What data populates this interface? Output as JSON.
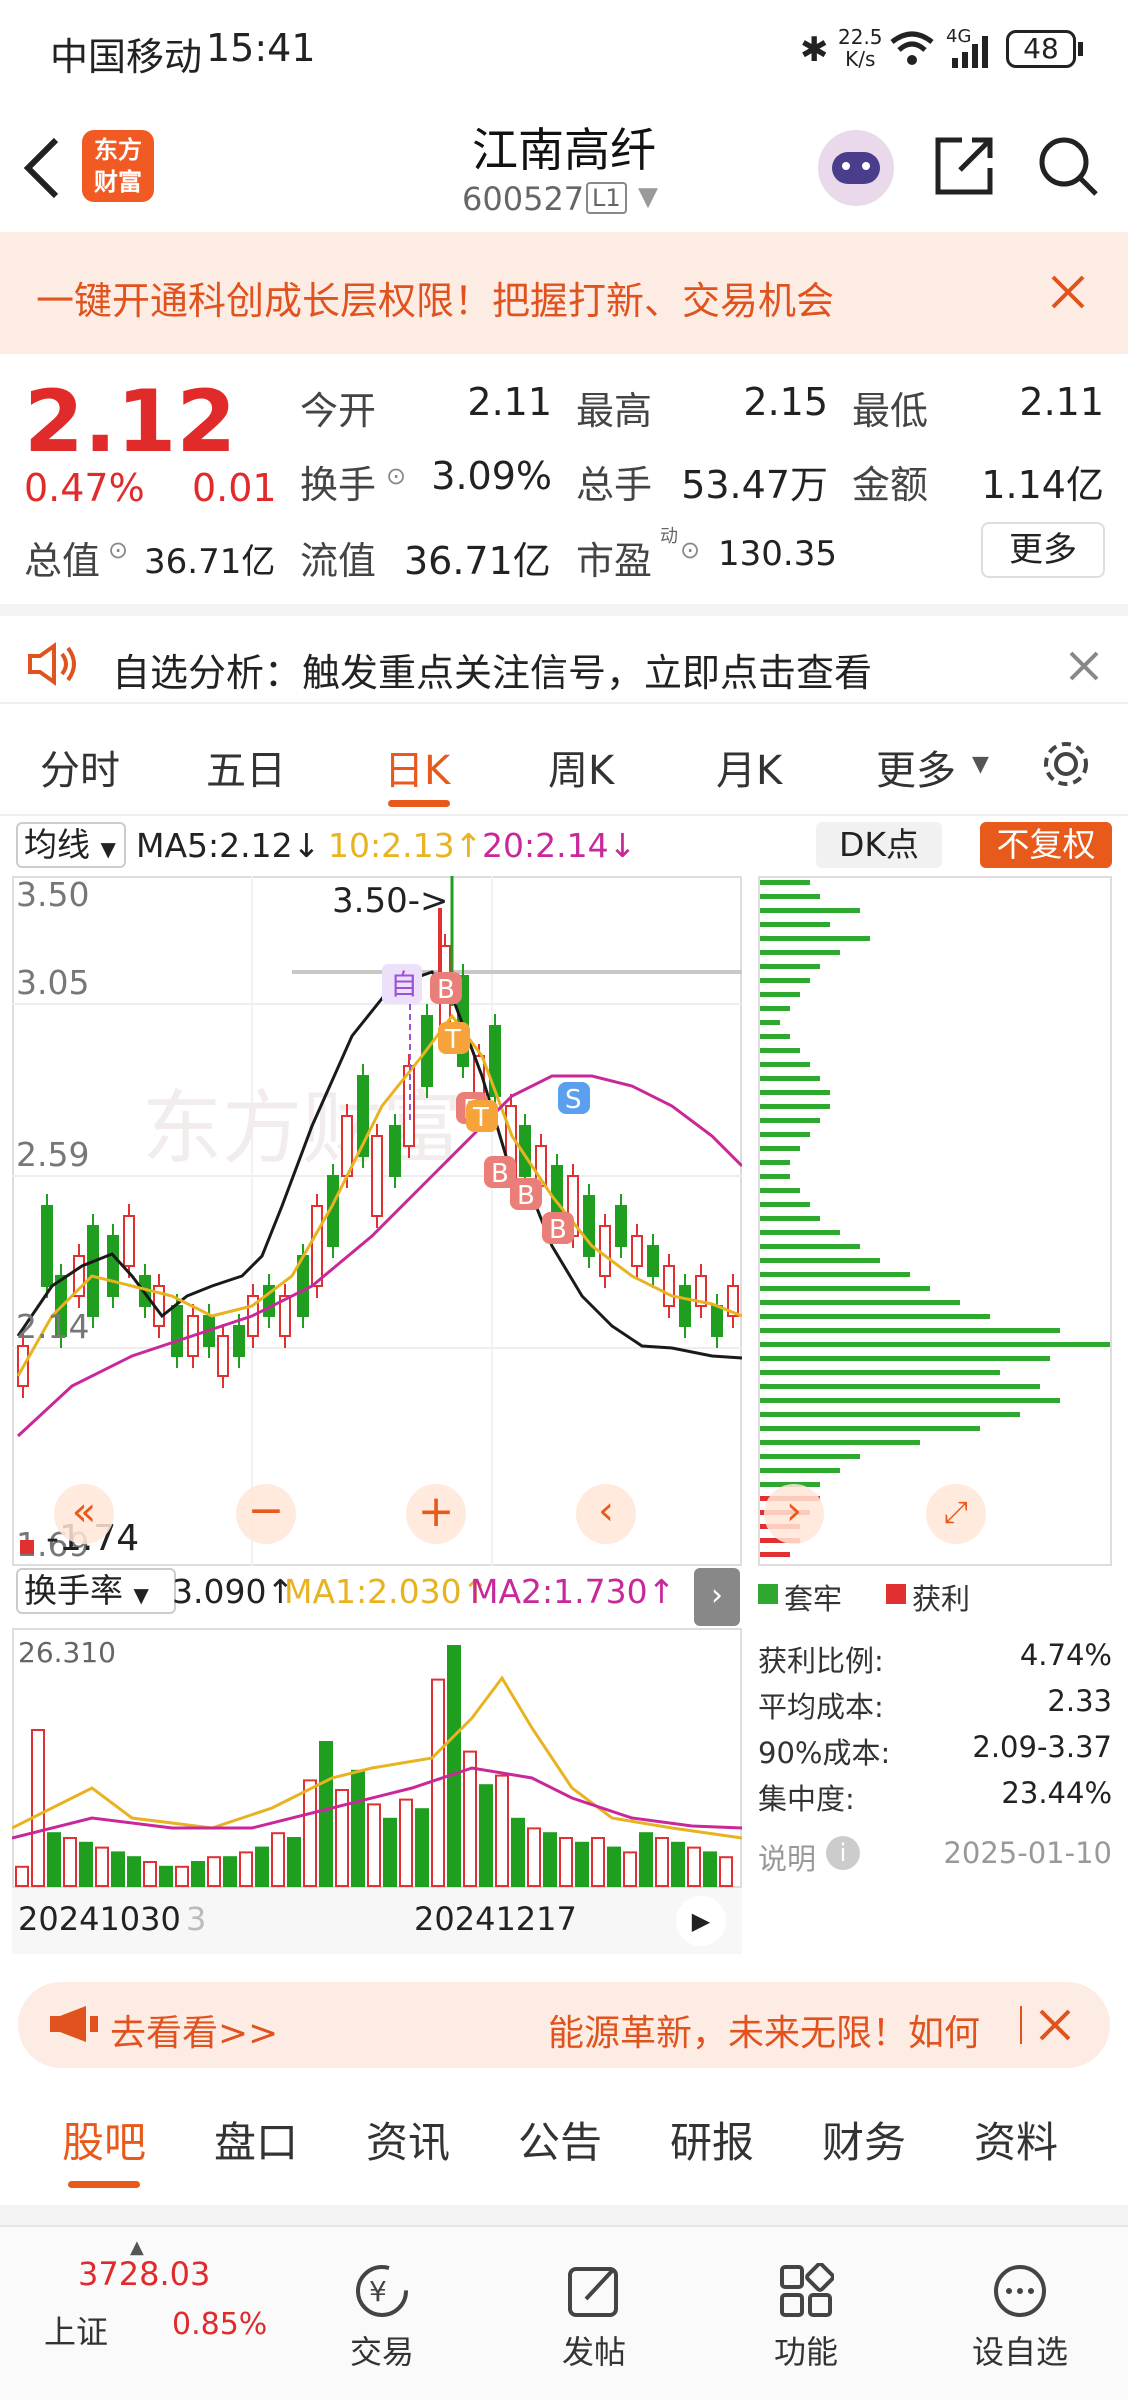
{
  "status": {
    "carrier": "中国移动",
    "time": "15:41",
    "speed_top": "22.5",
    "speed_bot": "K/s",
    "net": "4G",
    "battery": "48"
  },
  "header": {
    "logo_l1": "东方",
    "logo_l2": "财富",
    "name": "江南高纤",
    "code": "600527",
    "level": "L1"
  },
  "banner": {
    "text": "一键开通科创成长层权限！把握打新、交易机会"
  },
  "quote": {
    "price": "2.12",
    "pct": "0.47%",
    "chg": "0.01",
    "open_lbl": "今开",
    "open": "2.11",
    "high_lbl": "最高",
    "high": "2.15",
    "low_lbl": "最低",
    "low": "2.11",
    "turn_lbl": "换手",
    "turn": "3.09%",
    "vol_lbl": "总手",
    "vol": "53.47万",
    "amt_lbl": "金额",
    "amt": "1.14亿",
    "mcap_lbl": "总值",
    "mcap": "36.71亿",
    "float_lbl": "流值",
    "float": "36.71亿",
    "pe_lbl": "市盈",
    "pe_sup": "动",
    "pe": "130.35",
    "more": "更多"
  },
  "notice": {
    "text": "自选分析：触发重点关注信号，立即点击查看"
  },
  "tabs": [
    "分时",
    "五日",
    "日K",
    "周K",
    "月K",
    "更多"
  ],
  "active_tab": "日K",
  "kline": {
    "ma_btn": "均线",
    "ma5": "MA5:2.12↓",
    "ma10": "10:2.13↑",
    "ma20": "20:2.14↓",
    "dk": "DK点",
    "fq": "不复权",
    "ticks": [
      "3.50",
      "3.05",
      "2.59",
      "2.14",
      "1.69"
    ],
    "max_label": "3.50->",
    "min_label": "1.74",
    "self_tag": "自",
    "colors": {
      "up": "#e03030",
      "down": "#1f9e1f",
      "ma5": "#222222",
      "ma10": "#e8b320",
      "ma20": "#c8289a"
    }
  },
  "volume": {
    "btn": "换手率",
    "v": "3.090↑",
    "ma1": "MA1:2.030↑",
    "ma2": "MA2:1.730↑",
    "top": "26.310",
    "d1": "20241030",
    "d1_tail": "3",
    "d2": "20241217"
  },
  "chips": {
    "legend_a": "套牢",
    "legend_b": "获利",
    "rows": [
      {
        "l": "获利比例:",
        "v": "4.74%"
      },
      {
        "l": "平均成本:",
        "v": "2.33"
      },
      {
        "l": "90%成本:",
        "v": "2.09-3.37"
      },
      {
        "l": "集中度:",
        "v": "23.44%"
      }
    ],
    "note": "说明",
    "date": "2025-01-10"
  },
  "ad": {
    "left": "去看看>>",
    "right": "能源革新，未来无限！如何"
  },
  "bottom_tabs": [
    "股吧",
    "盘口",
    "资讯",
    "公告",
    "研报",
    "财务",
    "资料"
  ],
  "nav": {
    "index_val": "3728.03",
    "index_name": "上证",
    "index_pct": "0.85%",
    "trade": "交易",
    "post": "发帖",
    "func": "功能",
    "add": "设自选"
  }
}
